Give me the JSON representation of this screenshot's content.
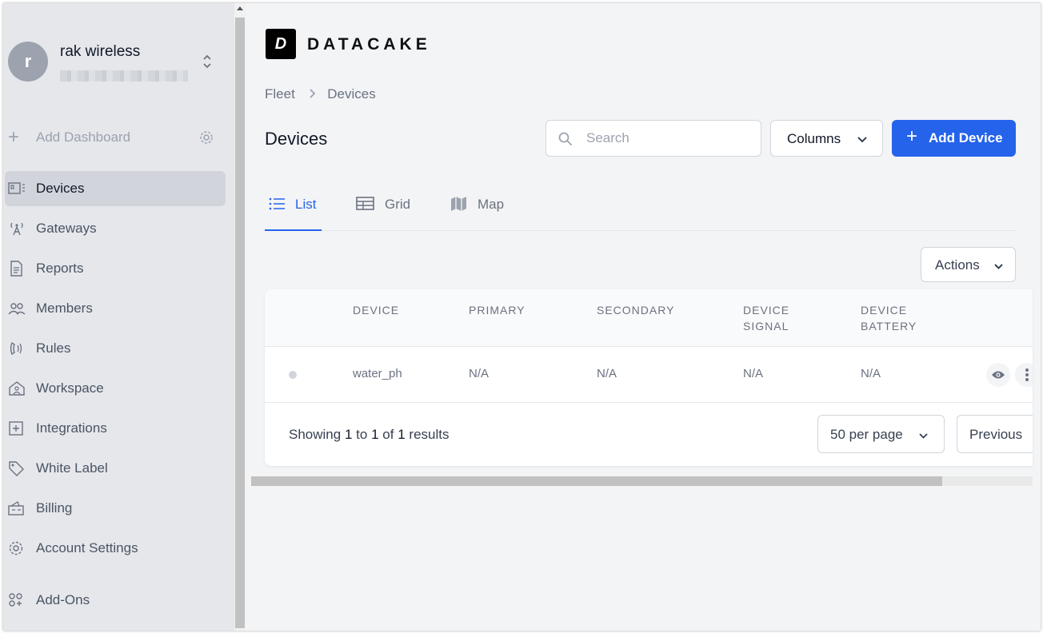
{
  "org": {
    "avatar_initial": "r",
    "name": "rak wireless"
  },
  "sidebar": {
    "add_dashboard_label": "Add Dashboard",
    "items": [
      {
        "label": "Devices",
        "icon": "device-icon",
        "active": true
      },
      {
        "label": "Gateways",
        "icon": "gateway-icon"
      },
      {
        "label": "Reports",
        "icon": "report-icon"
      },
      {
        "label": "Members",
        "icon": "members-icon"
      },
      {
        "label": "Rules",
        "icon": "rules-icon"
      },
      {
        "label": "Workspace",
        "icon": "workspace-icon"
      },
      {
        "label": "Integrations",
        "icon": "integrations-icon"
      },
      {
        "label": "White Label",
        "icon": "tag-icon"
      },
      {
        "label": "Billing",
        "icon": "billing-icon"
      },
      {
        "label": "Account Settings",
        "icon": "gear-icon"
      },
      {
        "label": "Add-Ons",
        "icon": "addons-icon"
      }
    ]
  },
  "brand": {
    "logo_letter": "D",
    "wordmark": "DATACAKE"
  },
  "breadcrumb": {
    "root": "Fleet",
    "current": "Devices"
  },
  "page": {
    "title": "Devices"
  },
  "toolbar": {
    "search_placeholder": "Search",
    "columns_label": "Columns",
    "add_device_label": "Add Device",
    "add_device_color": "#2563eb"
  },
  "tabs": [
    {
      "label": "List",
      "icon": "list-icon",
      "active": true
    },
    {
      "label": "Grid",
      "icon": "grid-icon"
    },
    {
      "label": "Map",
      "icon": "map-icon"
    }
  ],
  "actions_label": "Actions",
  "table": {
    "headers": {
      "device": "DEVICE",
      "primary": "PRIMARY",
      "secondary": "SECONDARY",
      "signal_1": "DEVICE",
      "signal_2": "SIGNAL",
      "battery_1": "DEVICE",
      "battery_2": "BATTERY"
    },
    "rows": [
      {
        "device": "water_ph",
        "primary": "N/A",
        "secondary": "N/A",
        "signal": "N/A",
        "battery": "N/A"
      }
    ]
  },
  "pagination": {
    "showing_prefix": "Showing",
    "from": "1",
    "to_word": "to",
    "to": "1",
    "of_word": "of",
    "total": "1",
    "results_word": "results",
    "per_page": "50 per page",
    "previous_label": "Previous"
  }
}
